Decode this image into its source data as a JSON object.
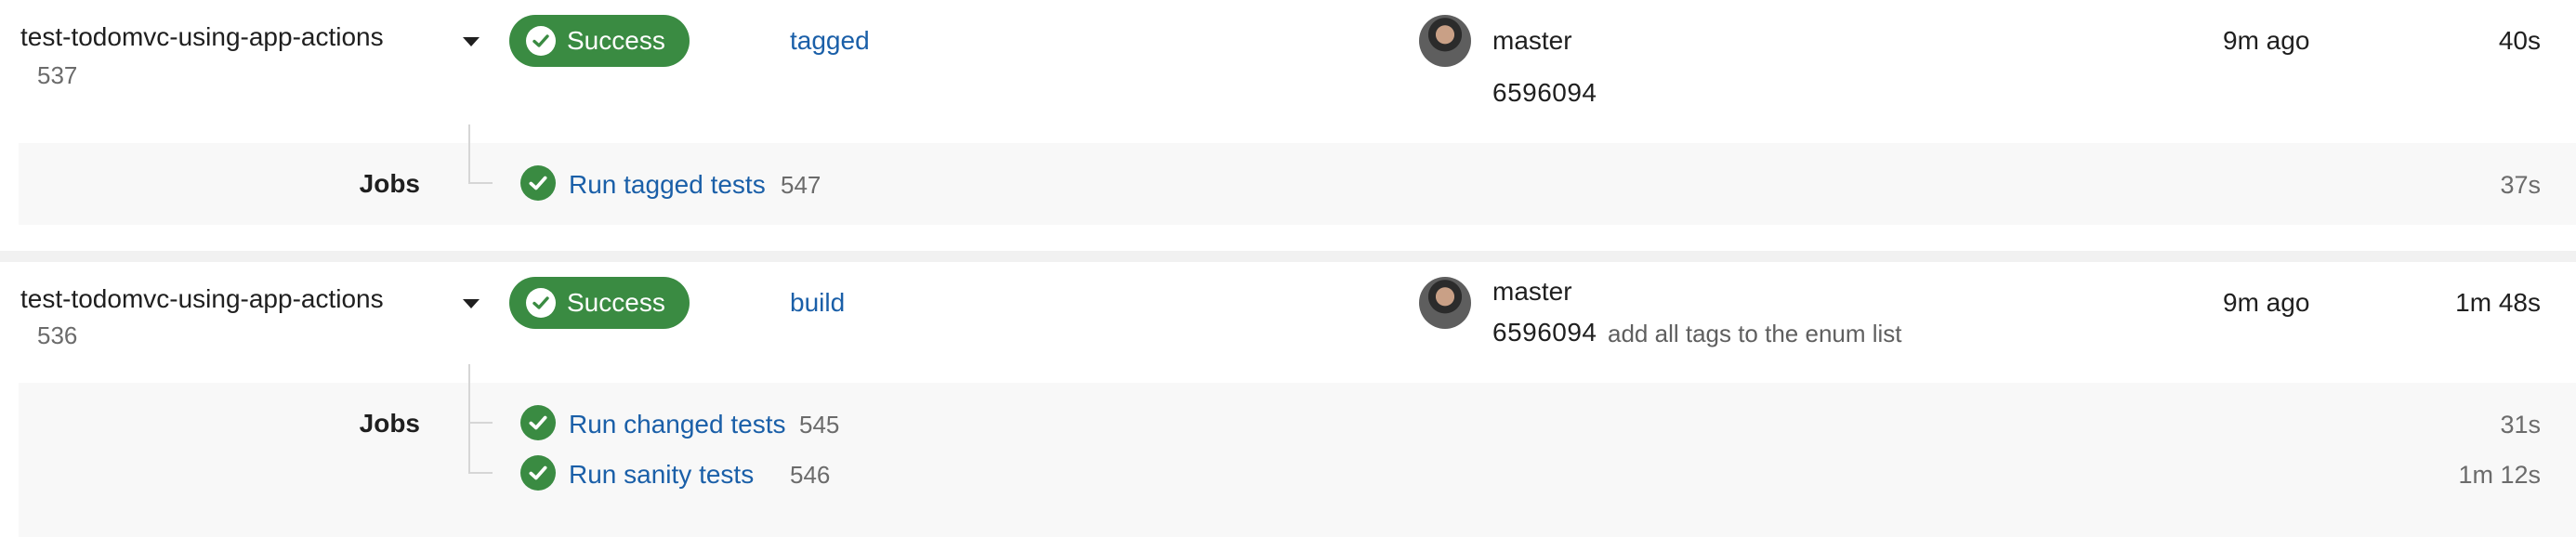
{
  "runs": [
    {
      "project": "test-todomvc-using-app-actions",
      "run_number": "537",
      "status": "Success",
      "workflow": "tagged",
      "branch": "master",
      "commit_sha": "6596094",
      "commit_message": "",
      "started": "9m ago",
      "duration": "40s",
      "jobs_label": "Jobs",
      "jobs": [
        {
          "name": "Run tagged tests",
          "number": "547",
          "duration": "37s"
        }
      ]
    },
    {
      "project": "test-todomvc-using-app-actions",
      "run_number": "536",
      "status": "Success",
      "workflow": "build",
      "branch": "master",
      "commit_sha": "6596094",
      "commit_message": "add all tags to the enum list",
      "started": "9m ago",
      "duration": "1m 48s",
      "jobs_label": "Jobs",
      "jobs": [
        {
          "name": "Run changed tests",
          "number": "545",
          "duration": "31s"
        },
        {
          "name": "Run sanity tests",
          "number": "546",
          "duration": "1m 12s"
        }
      ]
    }
  ],
  "colors": {
    "success": "#3a8b42",
    "link": "#1a5fa8"
  },
  "icons": {
    "status": "check-circle-icon",
    "expand": "caret-down-icon"
  }
}
